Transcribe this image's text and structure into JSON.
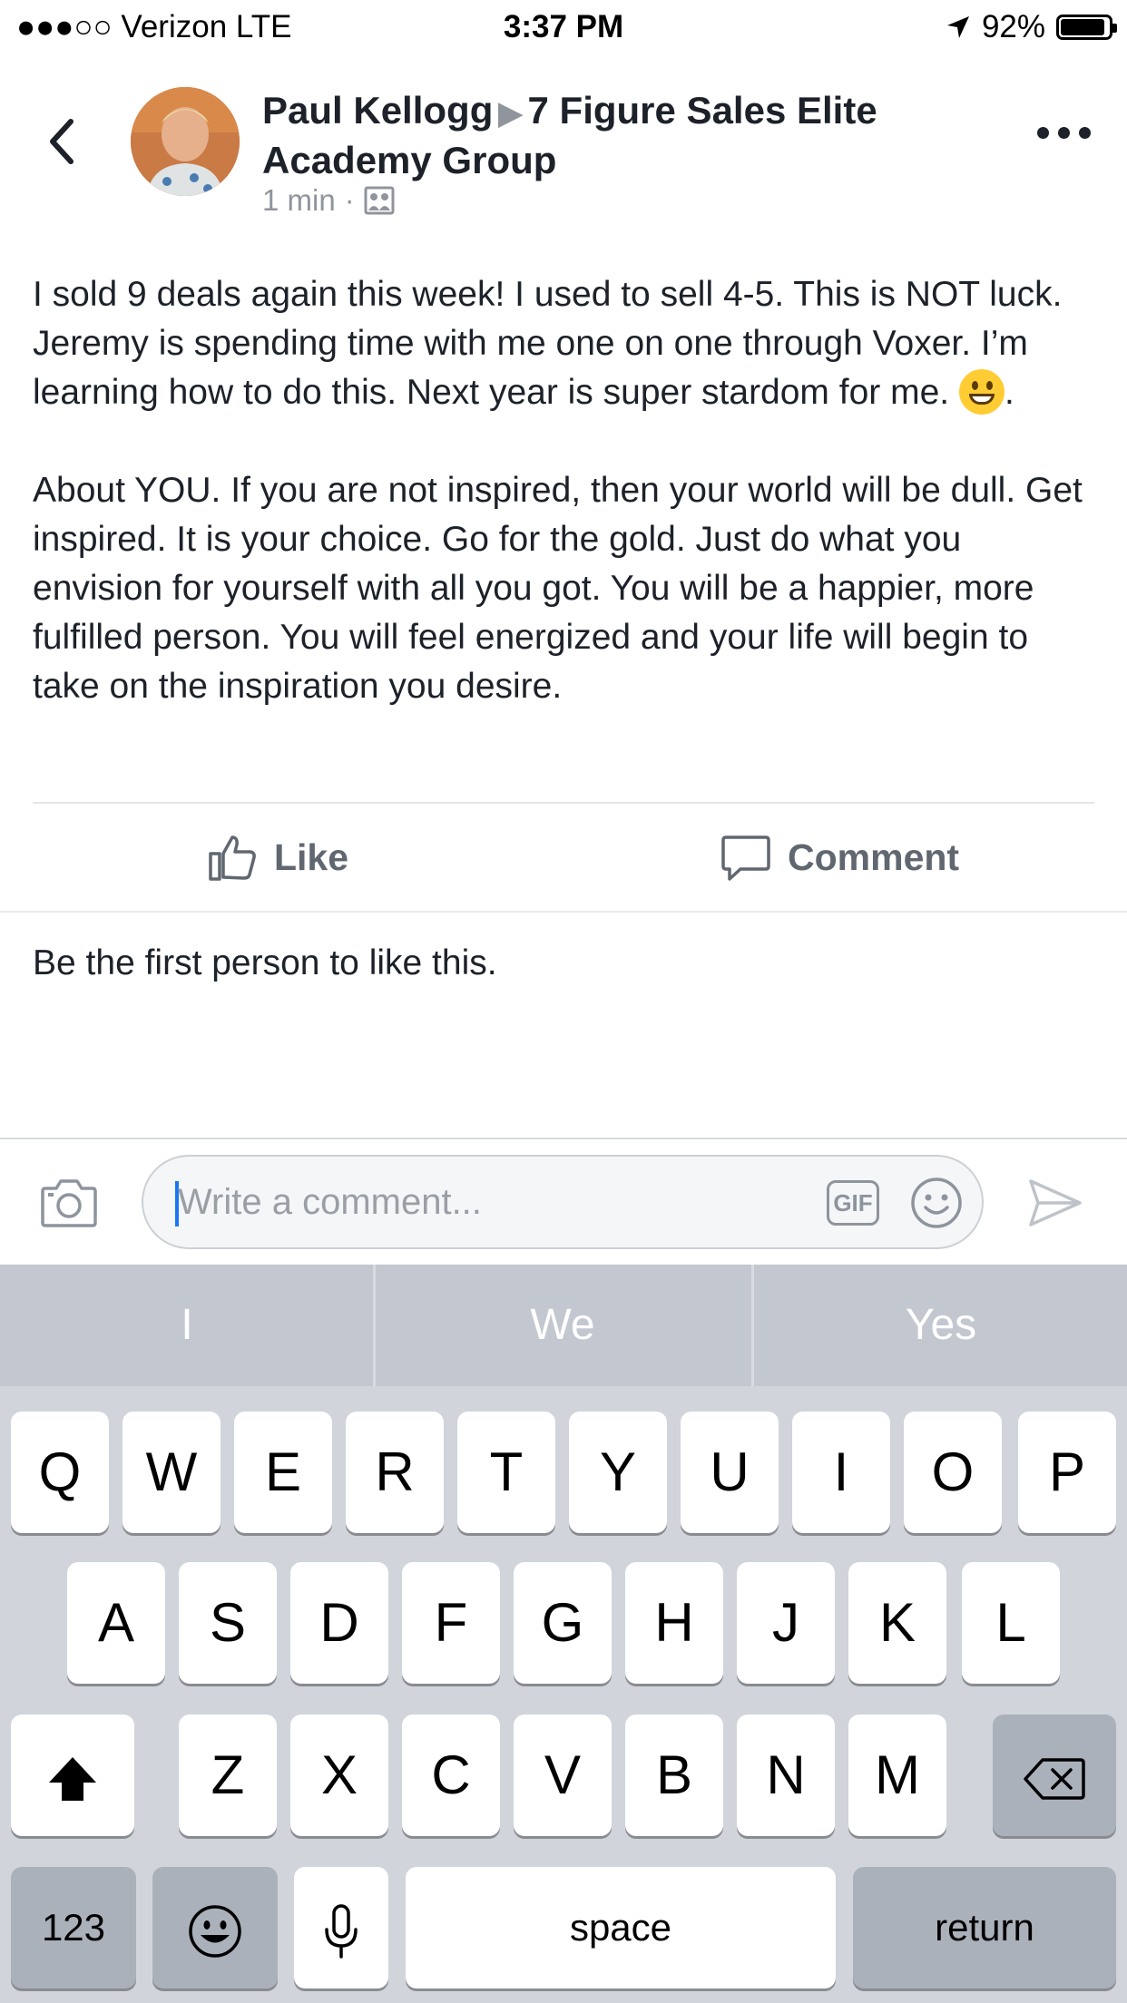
{
  "status_bar": {
    "carrier": "●●●○○ Verizon   LTE",
    "time": "3:37 PM",
    "battery": "92%"
  },
  "post": {
    "author": "Paul Kellogg",
    "group": "7 Figure Sales Elite Academy Group",
    "time": "1 min",
    "paragraph1_before_emoji": "I sold 9 deals again this week!  I used to sell 4-5. This is NOT luck. Jeremy is spending time with me one on one through Voxer. I’m learning how to do this. Next year is super stardom for me. ",
    "paragraph1_after_emoji": ".",
    "paragraph2": "About YOU. If you are not inspired, then your world will be dull. Get inspired. It is your choice. Go for the gold. Just do what you envision for yourself with all you got. You will be a happier, more fulfilled person. You will feel energized and your life will begin to take on the inspiration you desire."
  },
  "actions": {
    "like": "Like",
    "comment": "Comment"
  },
  "likes_text": "Be the first person to like this.",
  "comment_bar": {
    "placeholder": "Write a comment...",
    "gif": "GIF"
  },
  "keyboard": {
    "suggestions": [
      "I",
      "We",
      "Yes"
    ],
    "row1": [
      "Q",
      "W",
      "E",
      "R",
      "T",
      "Y",
      "U",
      "I",
      "O",
      "P"
    ],
    "row2": [
      "A",
      "S",
      "D",
      "F",
      "G",
      "H",
      "J",
      "K",
      "L"
    ],
    "row3": [
      "Z",
      "X",
      "C",
      "V",
      "B",
      "N",
      "M"
    ],
    "numbers": "123",
    "space": "space",
    "return": "return"
  },
  "colors": {
    "link_blue": "#1877f2",
    "muted": "#90949c",
    "keyboard_bg": "#d1d4db"
  },
  "icons": [
    "back-chevron-icon",
    "more-dots-icon",
    "group-icon",
    "thumbs-up-icon",
    "comment-bubble-icon",
    "camera-icon",
    "gif-icon",
    "smiley-icon",
    "send-icon",
    "shift-icon",
    "backspace-icon",
    "emoji-key-icon",
    "microphone-icon",
    "location-arrow-icon",
    "battery-icon"
  ]
}
